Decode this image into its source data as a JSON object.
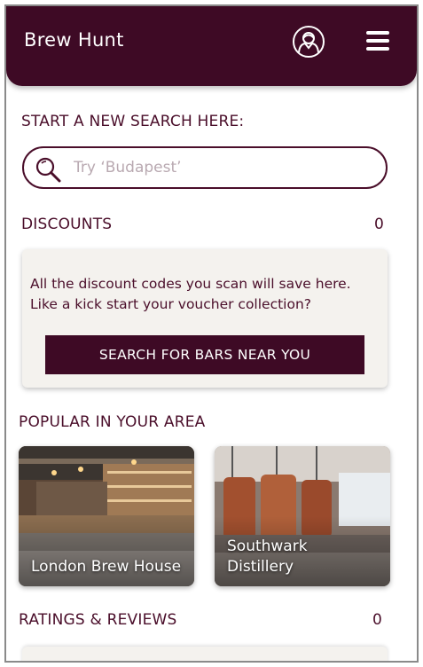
{
  "header": {
    "title": "Brew Hunt",
    "account_icon": "user-circle-icon",
    "menu_icon": "hamburger-menu-icon",
    "background_color": "#3e0a25"
  },
  "search": {
    "heading": "START A NEW SEARCH HERE:",
    "placeholder": "Try ‘Budapest’",
    "icon": "magnifier-icon"
  },
  "discounts": {
    "heading": "DISCOUNTS",
    "count": "0",
    "message": "All the discount codes you scan will save here. Like a kick start your voucher collection?",
    "button_label": "SEARCH FOR BARS NEAR YOU"
  },
  "popular": {
    "heading": "POPULAR IN YOUR AREA",
    "venues": [
      {
        "name": "London Brew House"
      },
      {
        "name": "Southwark Distillery"
      }
    ]
  },
  "reviews": {
    "heading": "RATINGS & REVIEWS",
    "count": "0"
  },
  "colors": {
    "accent": "#3e0a25",
    "text": "#4a0e2a",
    "card_background": "#f4f2ee"
  }
}
